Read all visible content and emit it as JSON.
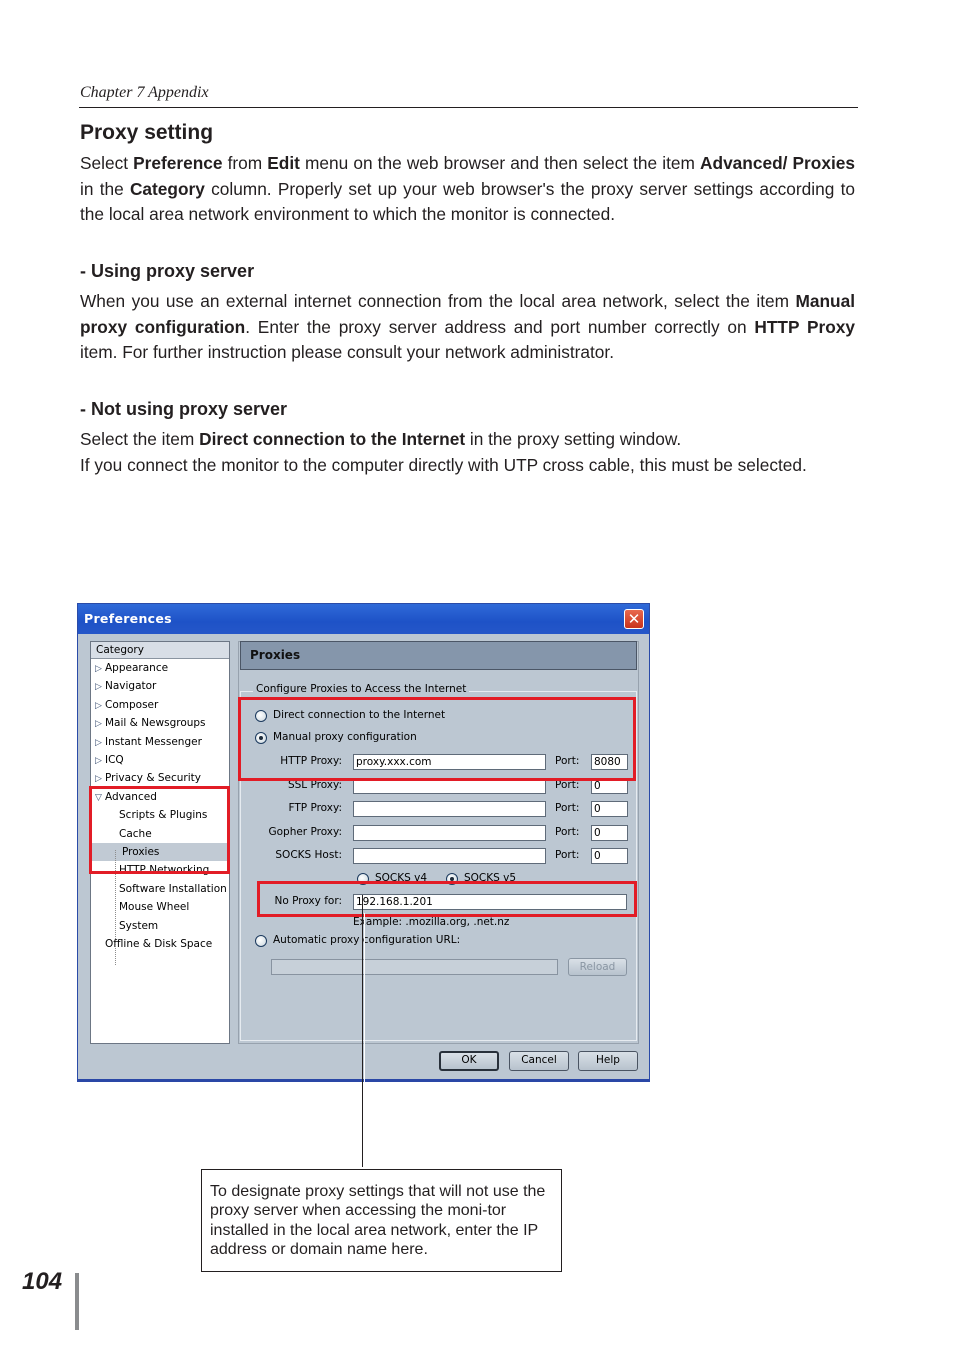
{
  "header": {
    "chapter": "Chapter 7 Appendix"
  },
  "section": {
    "title": "Proxy setting",
    "intro": [
      {
        "t": "Select ",
        "b": false
      },
      {
        "t": "Preference",
        "b": true
      },
      {
        "t": " from ",
        "b": false
      },
      {
        "t": "Edit",
        "b": true
      },
      {
        "t": " menu on the web browser and then select the item ",
        "b": false
      },
      {
        "t": "Advanced/ Proxies",
        "b": true
      },
      {
        "t": " in the ",
        "b": false
      },
      {
        "t": "Category",
        "b": true
      },
      {
        "t": " column. Properly set up your web browser's the proxy server settings according to the local area network environment to which the monitor is connected.",
        "b": false
      }
    ],
    "using_title": "- Using proxy server",
    "using_body": [
      {
        "t": "When you use an external internet connection from the local area network, select the item ",
        "b": false
      },
      {
        "t": "Manual proxy configuration",
        "b": true
      },
      {
        "t": ". Enter the proxy server address and port number correctly on ",
        "b": false
      },
      {
        "t": "HTTP Proxy",
        "b": true
      },
      {
        "t": " item. For further instruction please consult your network administrator.",
        "b": false
      }
    ],
    "not_using_title": "- Not using proxy server",
    "not_using_body": [
      {
        "t": "Select the item ",
        "b": false
      },
      {
        "t": "Direct connection to the Internet",
        "b": true
      },
      {
        "t": " in the proxy setting window.",
        "b": false
      }
    ],
    "not_using_body2": "If you connect the monitor to the computer directly with UTP cross cable, this must be selected."
  },
  "dialog": {
    "title": "Preferences",
    "close_glyph": "✕",
    "category_header": "Category",
    "categories": [
      {
        "label": "Appearance"
      },
      {
        "label": "Navigator"
      },
      {
        "label": "Composer"
      },
      {
        "label": "Mail & Newsgroups"
      },
      {
        "label": "Instant Messenger"
      },
      {
        "label": "ICQ"
      },
      {
        "label": "Privacy & Security"
      }
    ],
    "advanced": {
      "label": "Advanced",
      "children": [
        {
          "label": "Scripts & Plugins"
        },
        {
          "label": "Cache"
        },
        {
          "label": "Proxies",
          "selected": true
        },
        {
          "label": "HTTP Networking"
        },
        {
          "label": "Software Installation"
        },
        {
          "label": "Mouse Wheel"
        },
        {
          "label": "System"
        }
      ]
    },
    "offline": "Offline & Disk Space",
    "panel_title": "Proxies",
    "group_label": "Configure Proxies to Access the Internet",
    "radio_direct": "Direct connection to the Internet",
    "radio_manual": "Manual proxy configuration",
    "selected_mode": "manual",
    "proxies": [
      {
        "label": "HTTP Proxy:",
        "value": "proxy.xxx.com",
        "port_label": "Port:",
        "port": "8080"
      },
      {
        "label": "SSL Proxy:",
        "value": "",
        "port_label": "Port:",
        "port": "0"
      },
      {
        "label": "FTP Proxy:",
        "value": "",
        "port_label": "Port:",
        "port": "0"
      },
      {
        "label": "Gopher Proxy:",
        "value": "",
        "port_label": "Port:",
        "port": "0"
      },
      {
        "label": "SOCKS Host:",
        "value": "",
        "port_label": "Port:",
        "port": "0"
      }
    ],
    "socks_v4": "SOCKS v4",
    "socks_v5": "SOCKS v5",
    "socks_selected": "v5",
    "no_proxy_label": "No Proxy for:",
    "no_proxy_value": "192.168.1.201",
    "example": "Example: .mozilla.org, .net.nz",
    "radio_auto": "Automatic proxy configuration URL:",
    "auto_url": "",
    "reload": "Reload",
    "ok": "OK",
    "cancel": "Cancel",
    "help": "Help"
  },
  "callout": "To designate proxy settings that will not use the proxy server when accessing the moni-tor installed in the local area network, enter the IP address or domain name here.",
  "highlight_color": "#e21c26",
  "page_number": "104"
}
